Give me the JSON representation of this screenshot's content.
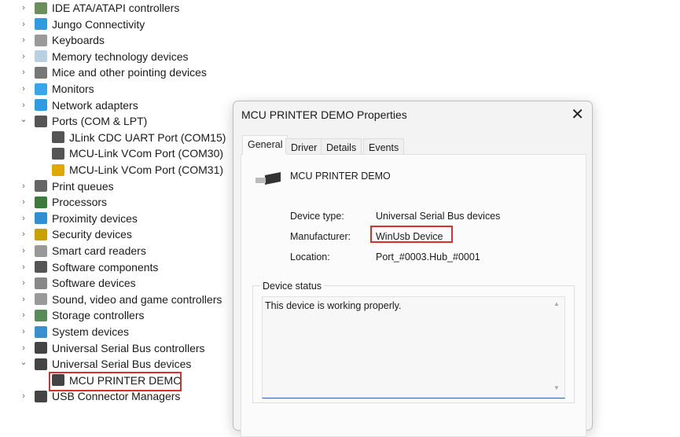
{
  "tree": [
    {
      "label": "IDE ATA/ATAPI controllers",
      "expanded": false,
      "icon": "ide-controller-icon",
      "color": "#6a8f5a"
    },
    {
      "label": "Jungo Connectivity",
      "expanded": false,
      "icon": "network-icon",
      "color": "#2f9be0"
    },
    {
      "label": "Keyboards",
      "expanded": false,
      "icon": "keyboard-icon",
      "color": "#9a9a9a"
    },
    {
      "label": "Memory technology devices",
      "expanded": false,
      "icon": "memory-icon",
      "color": "#b8d0e0"
    },
    {
      "label": "Mice and other pointing devices",
      "expanded": false,
      "icon": "mouse-icon",
      "color": "#777"
    },
    {
      "label": "Monitors",
      "expanded": false,
      "icon": "monitor-icon",
      "color": "#3aa5e8"
    },
    {
      "label": "Network adapters",
      "expanded": false,
      "icon": "network-icon",
      "color": "#2f9be0"
    },
    {
      "label": "Ports (COM & LPT)",
      "expanded": true,
      "icon": "port-icon",
      "color": "#555"
    },
    {
      "label": "JLink CDC UART Port (COM15)",
      "child": true,
      "icon": "port-icon",
      "color": "#555"
    },
    {
      "label": "MCU-Link VCom Port (COM30)",
      "child": true,
      "icon": "port-icon",
      "color": "#555"
    },
    {
      "label": "MCU-Link VCom Port (COM31)",
      "child": true,
      "icon": "port-warning-icon",
      "color": "#e0a800"
    },
    {
      "label": "Print queues",
      "expanded": false,
      "icon": "printer-icon",
      "color": "#666"
    },
    {
      "label": "Processors",
      "expanded": false,
      "icon": "processor-icon",
      "color": "#3d7a3d"
    },
    {
      "label": "Proximity devices",
      "expanded": false,
      "icon": "proximity-icon",
      "color": "#2f8fd0"
    },
    {
      "label": "Security devices",
      "expanded": false,
      "icon": "security-icon",
      "color": "#c9a100"
    },
    {
      "label": "Smart card readers",
      "expanded": false,
      "icon": "smartcard-icon",
      "color": "#999"
    },
    {
      "label": "Software components",
      "expanded": false,
      "icon": "software-component-icon",
      "color": "#555"
    },
    {
      "label": "Software devices",
      "expanded": false,
      "icon": "software-device-icon",
      "color": "#888"
    },
    {
      "label": "Sound, video and game controllers",
      "expanded": false,
      "icon": "speaker-icon",
      "color": "#999"
    },
    {
      "label": "Storage controllers",
      "expanded": false,
      "icon": "storage-icon",
      "color": "#5a8a5a"
    },
    {
      "label": "System devices",
      "expanded": false,
      "icon": "system-icon",
      "color": "#3a8fd0"
    },
    {
      "label": "Universal Serial Bus controllers",
      "expanded": false,
      "icon": "usb-icon",
      "color": "#444"
    },
    {
      "label": "Universal Serial Bus devices",
      "expanded": true,
      "icon": "usb-icon",
      "color": "#444"
    },
    {
      "label": "MCU PRINTER DEMO",
      "child": true,
      "icon": "usb-icon",
      "color": "#444"
    },
    {
      "label": "USB Connector Managers",
      "expanded": false,
      "icon": "usb-icon",
      "color": "#444"
    }
  ],
  "dialog": {
    "title": "MCU PRINTER DEMO Properties",
    "close": "✕",
    "tabs": [
      "General",
      "Driver",
      "Details",
      "Events"
    ],
    "device_name": "MCU PRINTER DEMO",
    "props": [
      {
        "label": "Device type:",
        "value": "Universal Serial Bus devices"
      },
      {
        "label": "Manufacturer:",
        "value": "WinUsb Device"
      },
      {
        "label": "Location:",
        "value": "Port_#0003.Hub_#0001"
      }
    ],
    "status_group": "Device status",
    "status_text": "This device is working properly."
  },
  "accent": "#d9302e"
}
